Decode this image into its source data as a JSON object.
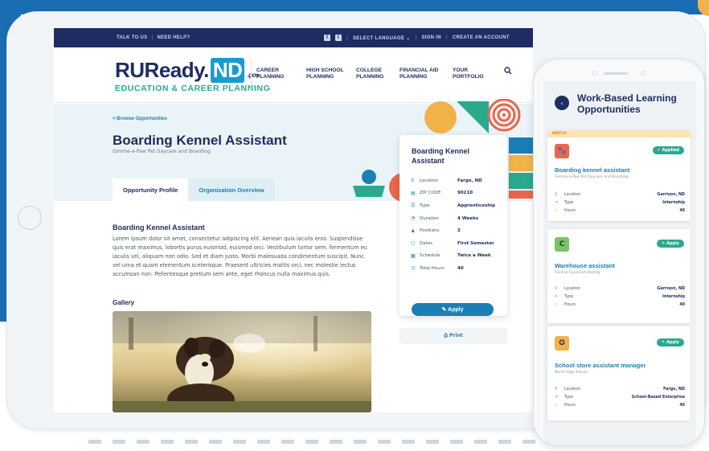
{
  "topbar": {
    "talk_to_us": "TALK TO US",
    "need_help": "NEED HELP?",
    "select_language": "SELECT LANGUAGE ⌄",
    "sign_in": "SIGN IN",
    "create_account": "CREATE AN ACCOUNT"
  },
  "logo": {
    "main": "RUReady.",
    "nd": "ND",
    "gov": ".gov",
    "sub": "EDUCATION & CAREER PLANNING"
  },
  "nav": [
    {
      "l1": "CAREER",
      "l2": "PLANNING"
    },
    {
      "l1": "HIGH SCHOOL",
      "l2": "PLANNING"
    },
    {
      "l1": "COLLEGE",
      "l2": "PLANNING"
    },
    {
      "l1": "FINANCIAL AID",
      "l2": "PLANNING"
    },
    {
      "l1": "YOUR",
      "l2": "PORTFOLIO"
    }
  ],
  "breadcrumb": "< Browse Opportunities",
  "opportunity": {
    "title": "Boarding Kennel Assistant",
    "org": "Gimme-a-Paw Pet Daycare and Boarding"
  },
  "tabs": {
    "profile": "Opportunity Profile",
    "org": "Organization Overview"
  },
  "section_title": "Boarding Kennel Assistant",
  "body_text": "Lorem ipsum dolor sit amet, consectetur adipiscing elit. Aenean quis iaculis eros. Suspendisse quis erat maximus, lobortis purus euismod, euismod orci. Vestibulum tortor sem, fermentum eu iaculis vel, aliquam non odio. Sed et diam justo. Morbi malesuada condimentum suscipit. Nunc vel urna et quam elementum scelerisque. Praesent ultricies mattis orci, nec molestie lectus accumsan non. Pellentesque pretium sem ante, eget rhoncus nulla maximus quis.",
  "gallery_title": "Gallery",
  "card": {
    "title": "Boarding Kennel Assistant",
    "rows": [
      {
        "icon": "⚲",
        "label": "Location",
        "value": "Fargo, ND"
      },
      {
        "icon": "▤",
        "label": "ZIP CODE",
        "value": "90210"
      },
      {
        "icon": "☰",
        "label": "Type",
        "value": "Apprenticeship"
      },
      {
        "icon": "◔",
        "label": "Duration",
        "value": "4 Weeks"
      },
      {
        "icon": "♟",
        "label": "Positions",
        "value": "2"
      },
      {
        "icon": "▢",
        "label": "Dates",
        "value": "First Semester"
      },
      {
        "icon": "▦",
        "label": "Schedule",
        "value": "Twice a Week"
      },
      {
        "icon": "◷",
        "label": "Total Hours",
        "value": "40"
      }
    ],
    "apply": "✎ Apply",
    "print": "⎙ Print"
  },
  "phone": {
    "title_l1": "Work-Based Learning",
    "title_l2": "Opportunities",
    "jobs": [
      {
        "match": "MATCH",
        "logo": "🐾",
        "badge": "✔ Applied",
        "title": "Boarding kennel assistant",
        "org": "Gimme-a-Paw Pet Daycare and Boarding",
        "location": "Garrison, ND",
        "type": "Internship",
        "hours": "40"
      },
      {
        "logo": "C",
        "badge": "✎ Apply",
        "title": "Warehouse assistant",
        "org": "Central Food Distributing",
        "location": "Garrison, ND",
        "type": "Internship",
        "hours": "40"
      },
      {
        "logo": "✪",
        "badge": "✎ Apply",
        "title": "School store assistant manager",
        "org": "North High School",
        "location": "Fargo, ND",
        "type": "School-Based Enterprise",
        "hours": "40"
      }
    ],
    "labels": {
      "location": "Location",
      "type": "Type",
      "hours": "Hours"
    }
  },
  "colors": {
    "navy": "#1f2c61",
    "brand_blue": "#1a7fb5",
    "teal": "#2aa98f",
    "orange": "#f2b24a",
    "coral": "#e8674a"
  }
}
